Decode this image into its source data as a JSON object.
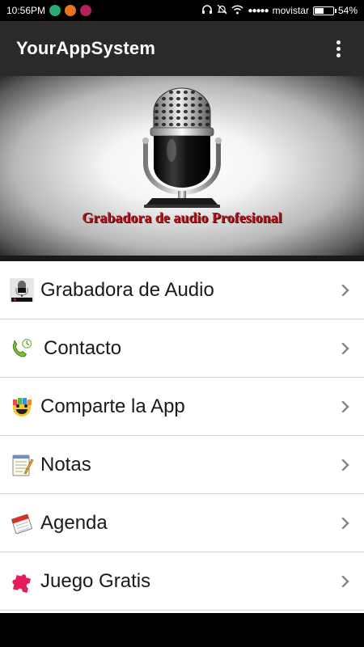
{
  "status_bar": {
    "time": "10:56PM",
    "carrier": "movistar",
    "signal_dots": "●●●●●",
    "battery_percent": "54%",
    "battery_level": 0.54
  },
  "app_bar": {
    "title": "YourAppSystem"
  },
  "banner": {
    "caption": "Grabadora de audio Profesional"
  },
  "menu": {
    "items": [
      {
        "label": "Grabadora de Audio",
        "icon": "microphone-icon"
      },
      {
        "label": "Contacto",
        "icon": "phone-icon"
      },
      {
        "label": "Comparte la App",
        "icon": "share-app-icon"
      },
      {
        "label": "Notas",
        "icon": "notepad-icon"
      },
      {
        "label": "Agenda",
        "icon": "calendar-icon"
      },
      {
        "label": "Juego Gratis",
        "icon": "puzzle-icon"
      }
    ]
  },
  "colors": {
    "app_bar": "#2a2a2a",
    "caption": "#b0141a",
    "chevron": "#888888"
  }
}
